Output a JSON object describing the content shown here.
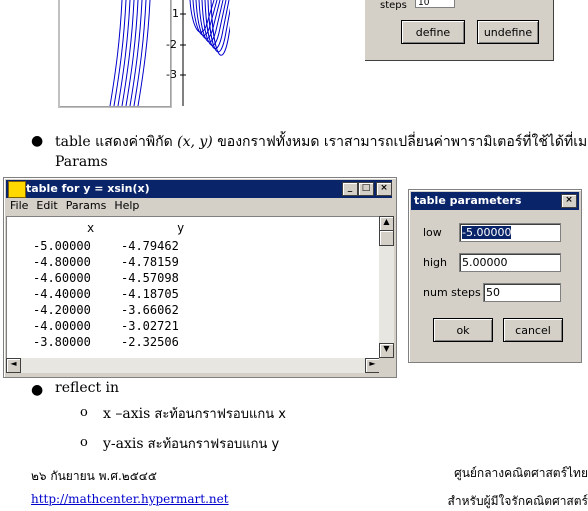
{
  "graph": {
    "y_ticks": [
      "1",
      "-2",
      "-3"
    ]
  },
  "define_dialog": {
    "steps_label": "steps",
    "steps_value": "10",
    "define_label": "define",
    "undefine_label": "undefine"
  },
  "bullet1": {
    "prefix": "table",
    "text": " แสดงค่าพิกัด ",
    "math": "(x, y)",
    "text2": " ของกราฟทั้งหมด  เราสามารถเปลี่ยนค่าพารามิเตอร์ที่ใช้ได้ที่เมนู",
    "line2": "Params"
  },
  "table_window": {
    "title": "table for y = xsin(x)",
    "menu": [
      "File",
      "Edit",
      "Params",
      "Help"
    ],
    "header_x": "x",
    "header_y": "y",
    "rows": [
      [
        "-5.00000",
        "-4.79462"
      ],
      [
        "-4.80000",
        "-4.78159"
      ],
      [
        "-4.60000",
        "-4.57098"
      ],
      [
        "-4.40000",
        "-4.18705"
      ],
      [
        "-4.20000",
        "-3.66062"
      ],
      [
        "-4.00000",
        "-3.02721"
      ],
      [
        "-3.80000",
        "-2.32506"
      ]
    ]
  },
  "params_dialog": {
    "title": "table parameters",
    "low_label": "low",
    "low_value": "-5.00000",
    "high_label": "high",
    "high_value": "5.00000",
    "steps_label": "num steps",
    "steps_value": "50",
    "ok_label": "ok",
    "cancel_label": "cancel"
  },
  "bullet2": {
    "text": "reflect in",
    "sub1_axis": "x –axis",
    "sub1_text": " สะท้อนกราฟรอบแกน x",
    "sub2_axis": "y-axis",
    "sub2_text": " สะท้อนกราฟรอบแกน y"
  },
  "footer": {
    "date": "๒๖ กันยายน พ.ศ.๒๕๔๕",
    "org": "ศูนย์กลางคณิตศาสตร์ไทย",
    "url": "http://mathcenter.hypermart.net",
    "tagline": "สำหรับผู้มีใจรักคณิตศาสตร์"
  }
}
